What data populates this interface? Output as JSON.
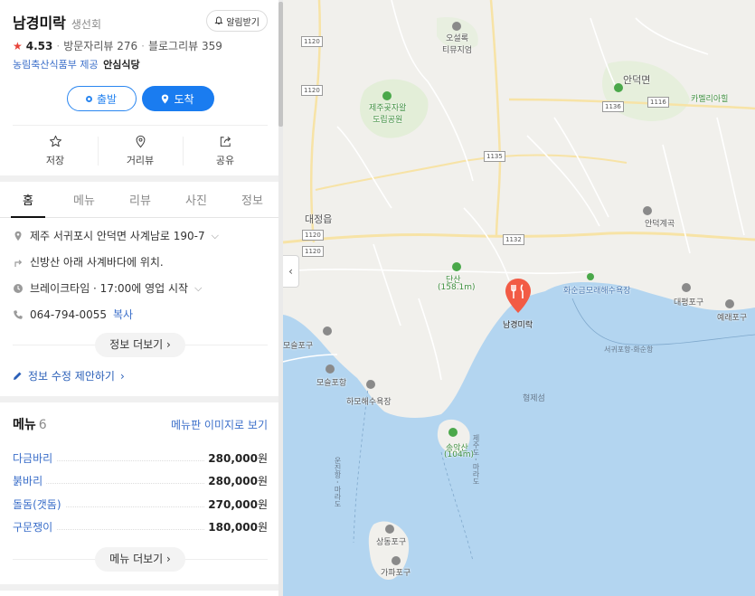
{
  "place": {
    "name": "남경미락",
    "category": "생선회",
    "alarm_label": "알림받기",
    "rating": "4.53",
    "visitor_reviews": "방문자리뷰 276",
    "blog_reviews": "블로그리뷰 359",
    "provider": "농림축산식품부 제공",
    "badge": "안심식당",
    "star_color": "#e8443a"
  },
  "route": {
    "start_label": "출발",
    "arrive_label": "도착",
    "accent": "#1a7cf0"
  },
  "actions": [
    {
      "label": "저장",
      "icon": "star-outline-icon"
    },
    {
      "label": "거리뷰",
      "icon": "pin-outline-icon"
    },
    {
      "label": "공유",
      "icon": "share-icon"
    }
  ],
  "tabs": [
    {
      "label": "홈",
      "active": true
    },
    {
      "label": "메뉴"
    },
    {
      "label": "리뷰"
    },
    {
      "label": "사진"
    },
    {
      "label": "정보"
    }
  ],
  "info": {
    "address": "제주 서귀포시 안덕면 사계남로 190-7",
    "directions": "신방산 아래 사계바다에 위치.",
    "hours": "브레이크타임 · 17:00에 영업 시작",
    "phone": "064-794-0055",
    "copy_label": "복사",
    "more_label": "정보 더보기",
    "edit_label": "정보 수정 제안하기"
  },
  "menu": {
    "title": "메뉴",
    "count": "6",
    "image_link": "메뉴판 이미지로 보기",
    "items": [
      {
        "name": "다금바리",
        "price": "280,000",
        "unit": "원"
      },
      {
        "name": "붉바리",
        "price": "280,000",
        "unit": "원"
      },
      {
        "name": "돌돔(갯돔)",
        "price": "270,000",
        "unit": "원"
      },
      {
        "name": "구문쟁이",
        "price": "180,000",
        "unit": "원"
      }
    ],
    "more_label": "메뉴 더보기"
  },
  "map": {
    "marker_label": "남경미락",
    "marker_color": "#f25b45",
    "labels": {
      "osullok": "오설록\n티뮤지엄",
      "jeju_gotjawal": "제주곶자왈\n도립공원",
      "andeok": "안덕면",
      "camellia": "카멜리아힐",
      "daejeong": "대정읍",
      "andeokgyegok": "안덕계곡",
      "dansan": "단산",
      "dansan_h": "(158.1m)",
      "hwasun": "화순금모래해수욕장",
      "daepyeong": "대평포구",
      "yerae": "예래포구",
      "moseulpo_port": "모슬포항",
      "moseulpo": "모슬포구",
      "hamo": "하모해수욕장",
      "hyeongje": "형제섬",
      "songaksan": "송악산",
      "songaksan_h": "(104m)",
      "route_sea": "서귀포항-화순항",
      "ferry1": "운진항 - 마라도",
      "ferry2": "제주도 - 마라도",
      "sangdong": "상동포구",
      "gapa": "가파포구"
    },
    "roads": [
      "1120",
      "1120",
      "1120",
      "1136",
      "1116",
      "1135",
      "1132",
      "1120"
    ]
  }
}
